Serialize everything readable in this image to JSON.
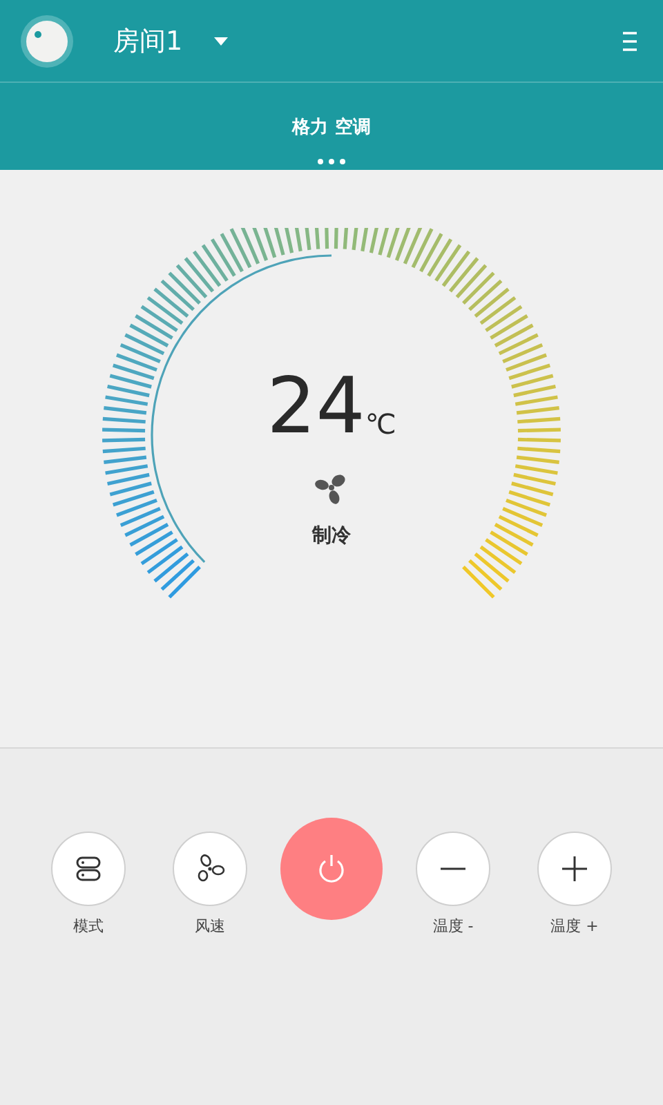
{
  "header": {
    "room": "房间1",
    "device": "格力 空调"
  },
  "dial": {
    "temperature": "24",
    "unit": "℃",
    "mode": "制冷"
  },
  "controls": [
    {
      "kind": "mode",
      "label": "模式"
    },
    {
      "kind": "fan",
      "label": "风速"
    },
    {
      "kind": "power",
      "on": false
    },
    {
      "kind": "minus",
      "label": "温度 -"
    },
    {
      "kind": "plus",
      "label": "温度 +"
    }
  ]
}
